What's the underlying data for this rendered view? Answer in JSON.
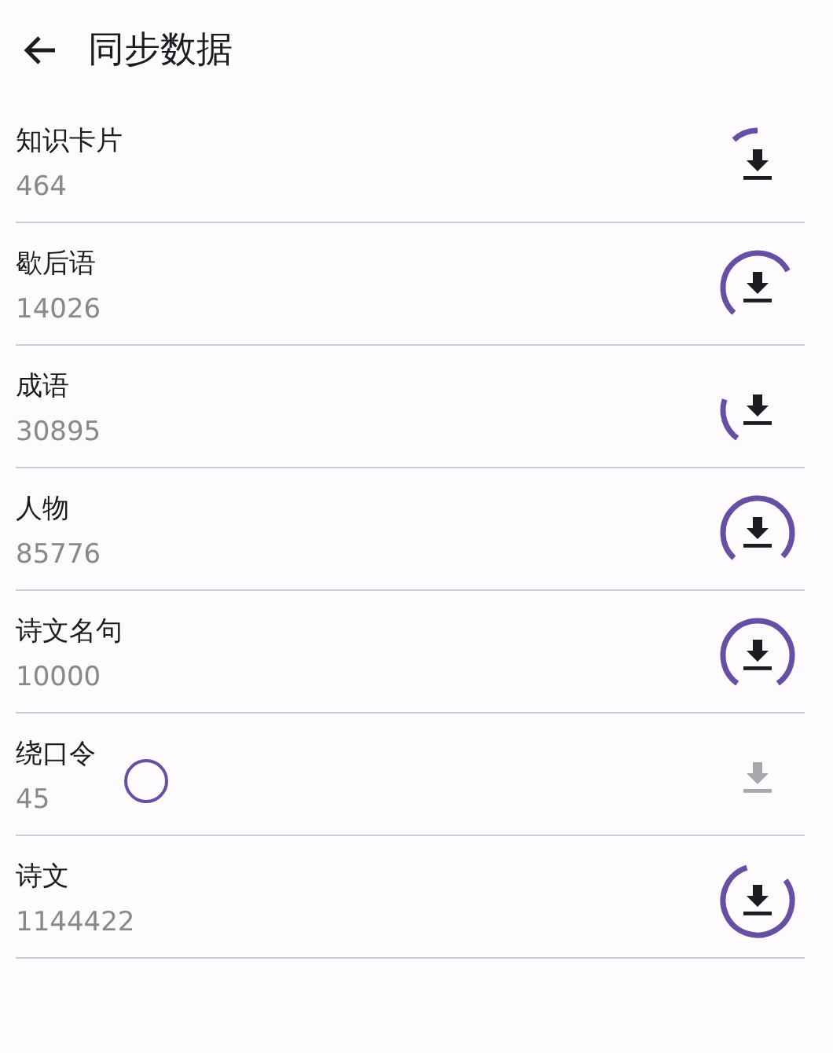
{
  "title": "同步数据",
  "items": [
    {
      "name": "知识卡片",
      "count": "464",
      "disabled": false
    },
    {
      "name": "歇后语",
      "count": "14026",
      "disabled": false
    },
    {
      "name": "成语",
      "count": "30895",
      "disabled": false
    },
    {
      "name": "人物",
      "count": "85776",
      "disabled": false
    },
    {
      "name": "诗文名句",
      "count": "10000",
      "disabled": false
    },
    {
      "name": "绕口令",
      "count": "45",
      "disabled": true
    },
    {
      "name": "诗文",
      "count": "1144422",
      "disabled": false
    }
  ]
}
